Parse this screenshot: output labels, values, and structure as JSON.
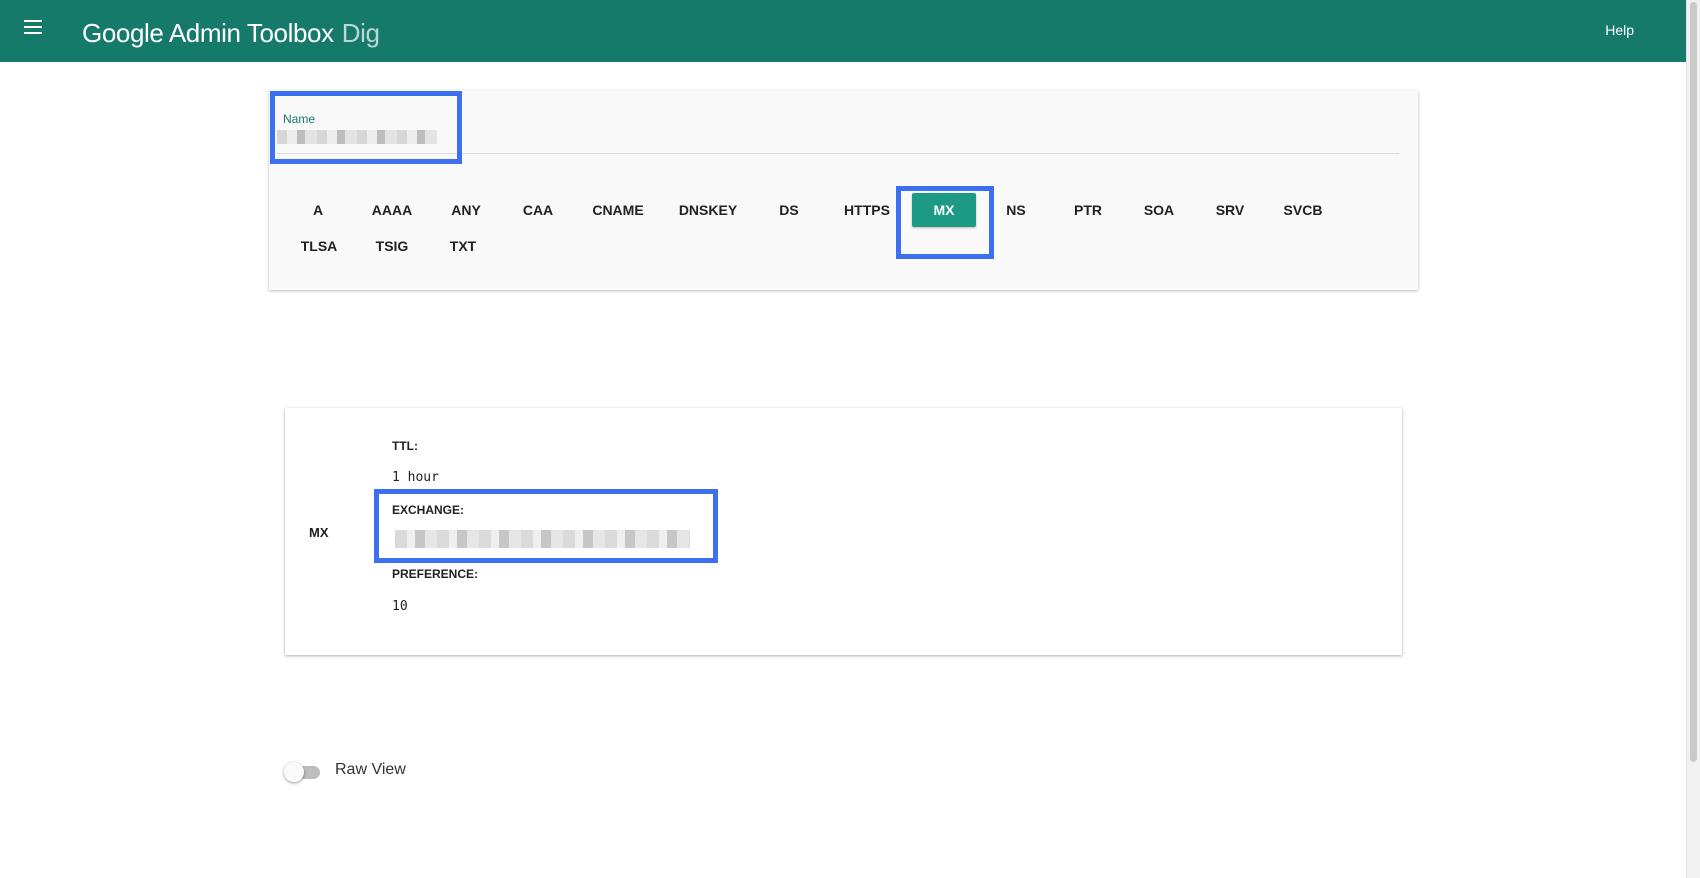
{
  "app": {
    "title": "Google Admin Toolbox",
    "subtitle": "Dig",
    "help_label": "Help"
  },
  "query": {
    "name_label": "Name",
    "name_value_redacted": true,
    "record_types": [
      "A",
      "AAAA",
      "ANY",
      "CAA",
      "CNAME",
      "DNSKEY",
      "DS",
      "HTTPS",
      "MX",
      "NS",
      "PTR",
      "SOA",
      "SRV",
      "SVCB",
      "TLSA",
      "TSIG",
      "TXT"
    ],
    "selected_type": "MX"
  },
  "result": {
    "record_type": "MX",
    "ttl_label": "TTL:",
    "ttl_value": "1 hour",
    "exchange_label": "EXCHANGE:",
    "exchange_value_redacted": true,
    "preference_label": "PREFERENCE:",
    "preference_value": "10"
  },
  "raw_view": {
    "label": "Raw View",
    "enabled": false
  },
  "colors": {
    "header": "#167a6a",
    "accent": "#1c9a86",
    "highlight": "#3c70f0"
  }
}
